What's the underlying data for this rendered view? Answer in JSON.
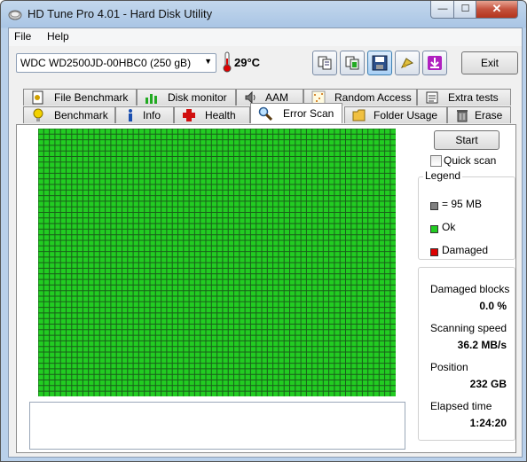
{
  "window": {
    "title": "HD Tune Pro 4.01 - Hard Disk Utility",
    "min_glyph": "—",
    "max_glyph": "☐",
    "close_glyph": "✕"
  },
  "menu": {
    "file": "File",
    "help": "Help"
  },
  "toolbar": {
    "drive": "WDC WD2500JD-00HBC0 (250 gB)",
    "temperature": "29°C",
    "exit": "Exit",
    "icons": [
      "copy-icon",
      "copy-all-icon",
      "save-icon",
      "options-icon",
      "download-icon"
    ]
  },
  "tabs": {
    "row1": [
      "File Benchmark",
      "Disk monitor",
      "AAM",
      "Random Access",
      "Extra tests"
    ],
    "row2": [
      "Benchmark",
      "Info",
      "Health",
      "Error Scan",
      "Folder Usage",
      "Erase"
    ],
    "selected": "Error Scan"
  },
  "scan": {
    "start": "Start",
    "quick_scan": "Quick scan",
    "quick_scan_checked": false,
    "legend_title": "Legend",
    "legend": [
      {
        "label": "= 95 MB",
        "color": "#808080"
      },
      {
        "label": "Ok",
        "color": "#22cc22"
      },
      {
        "label": "Damaged",
        "color": "#dd0000"
      }
    ],
    "stats": {
      "damaged_label": "Damaged blocks",
      "damaged_value": "0.0 %",
      "speed_label": "Scanning speed",
      "speed_value": "36.2 MB/s",
      "position_label": "Position",
      "position_value": "232 GB",
      "elapsed_label": "Elapsed time",
      "elapsed_value": "1:24:20"
    },
    "block_color": "#22cc22",
    "grid_color": "#1a5e1a"
  }
}
